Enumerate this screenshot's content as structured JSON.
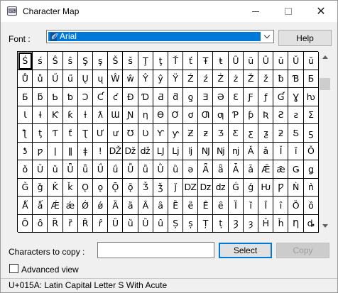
{
  "window": {
    "title": "Character Map",
    "app_icon": "character-map-icon",
    "controls": {
      "minimize_icon": "minimize-icon",
      "maximize_icon": "maximize-icon",
      "close_icon": "close-icon"
    }
  },
  "font": {
    "label": "Font :",
    "selected": "Arial",
    "icon": "opentype-font-icon",
    "dropdown_icon": "chevron-down-icon"
  },
  "buttons": {
    "help": "Help",
    "select": "Select",
    "copy": "Copy"
  },
  "grid": {
    "selected_index": 0,
    "rows": [
      [
        "Ś",
        "ś",
        "Ŝ",
        "ŝ",
        "Ş",
        "ş",
        "Š",
        "š",
        "Ţ",
        "ţ",
        "Ť",
        "ť",
        "Ŧ",
        "ŧ",
        "Ũ",
        "ũ",
        "Ū",
        "ū",
        "Ŭ",
        "ŭ"
      ],
      [
        "Ů",
        "ů",
        "Ű",
        "ű",
        "Ų",
        "ų",
        "Ŵ",
        "ŵ",
        "Ŷ",
        "ŷ",
        "Ÿ",
        "Ź",
        "ź",
        "Ż",
        "ż",
        "Ž",
        "ž",
        "ƀ",
        "Ɓ",
        "Ƃ"
      ],
      [
        "Б",
        "ƃ",
        "Ƅ",
        "ƅ",
        "Ɔ",
        "Ƈ",
        "ƈ",
        "Ɖ",
        "Ɗ",
        "Ƌ",
        "ƌ",
        "ƍ",
        "Ǝ",
        "Ə",
        "Ɛ",
        "Ƒ",
        "ƒ",
        "Ɠ",
        "Ɣ",
        "ƕ"
      ],
      [
        "Ɩ",
        "Ɨ",
        "Ƙ",
        "ƙ",
        "ƚ",
        "ƛ",
        "Ɯ",
        "Ɲ",
        "ƞ",
        "Ɵ",
        "Ơ",
        "ơ",
        "Ƣ",
        "ƣ",
        "Ƥ",
        "ƥ",
        "Ʀ",
        "Ƨ",
        "ƨ",
        "Ʃ"
      ],
      [
        "ƪ",
        "ƫ",
        "Ƭ",
        "ƭ",
        "Ʈ",
        "Ư",
        "ư",
        "Ʊ",
        "Ʋ",
        "Ƴ",
        "ƴ",
        "Ƶ",
        "ƶ",
        "Ʒ",
        "Ƹ",
        "ƹ",
        "ƺ",
        "ƻ",
        "Ƽ",
        "ƽ"
      ],
      [
        "ƾ",
        "ƿ",
        "ǀ",
        "ǁ",
        "ǂ",
        "ǃ",
        "Ǆ",
        "ǅ",
        "ǆ",
        "Ǉ",
        "ǈ",
        "ǉ",
        "Ǌ",
        "ǋ",
        "ǌ",
        "Ǎ",
        "ǎ",
        "Ǐ",
        "ǐ",
        "Ǒ"
      ],
      [
        "ǒ",
        "Ǔ",
        "ǔ",
        "Ǖ",
        "ǖ",
        "Ǘ",
        "ǘ",
        "Ǚ",
        "ǚ",
        "Ǜ",
        "ǜ",
        "ǝ",
        "Ǟ",
        "ǟ",
        "Ǡ",
        "ǡ",
        "Ǣ",
        "ǣ",
        "Ǥ",
        "ǥ"
      ],
      [
        "Ǧ",
        "ǧ",
        "Ǩ",
        "ǩ",
        "Ǫ",
        "ǫ",
        "Ǭ",
        "ǭ",
        "Ǯ",
        "ǯ",
        "ǰ",
        "Ǳ",
        "ǲ",
        "ǳ",
        "Ǵ",
        "ǵ",
        "Ƕ",
        "Ƿ",
        "Ǹ",
        "ǹ"
      ],
      [
        "Ǻ",
        "ǻ",
        "Ǽ",
        "ǽ",
        "Ǿ",
        "ǿ",
        "Ȁ",
        "ȁ",
        "Ȃ",
        "ȃ",
        "Ȅ",
        "ȅ",
        "Ȇ",
        "ȇ",
        "Ȉ",
        "ȉ",
        "Ȋ",
        "ȋ",
        "Ȍ",
        "ȍ"
      ],
      [
        "Ȏ",
        "ȏ",
        "Ȑ",
        "ȑ",
        "Ȓ",
        "ȓ",
        "Ȕ",
        "ȕ",
        "Ȗ",
        "ȗ",
        "Ș",
        "ș",
        "Ț",
        "ț",
        "Ȝ",
        "ȝ",
        "Ȟ",
        "ȟ",
        "Ƞ",
        "ȡ"
      ]
    ]
  },
  "scrollbar": {
    "up_icon": "scroll-up-arrow-icon",
    "down_icon": "scroll-down-arrow-icon"
  },
  "copy": {
    "label": "Characters to copy :",
    "value": ""
  },
  "advanced": {
    "label": "Advanced view",
    "checked": false
  },
  "status": {
    "text": "U+015A: Latin Capital Letter S With Acute"
  }
}
